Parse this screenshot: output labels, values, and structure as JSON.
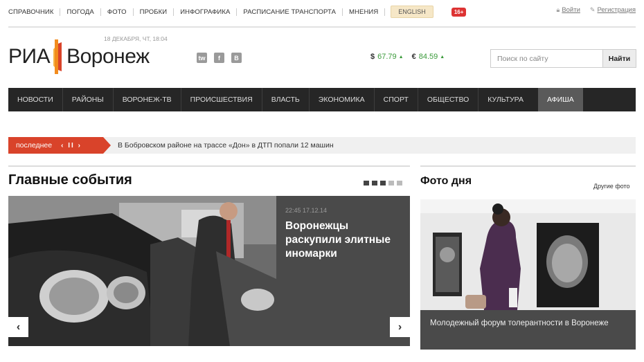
{
  "topnav": {
    "links": [
      "СПРАВОЧНИК",
      "ПОГОДА",
      "ФОТО",
      "ПРОБКИ",
      "ИНФОГРАФИКА",
      "РАСПИСАНИЕ ТРАНСПОРТА",
      "МНЕНИЯ"
    ],
    "english": "ENGLISH",
    "age_rating": "16+",
    "login": "Войти",
    "register": "Регистрация"
  },
  "header": {
    "date": "18 ДЕКАБРЯ, ЧТ, 18:04",
    "logo_left": "РИА",
    "logo_right": "Воронеж",
    "social": [
      "tw",
      "f",
      "В"
    ],
    "rates": [
      {
        "currency": "$",
        "value": "67.79"
      },
      {
        "currency": "€",
        "value": "84.59"
      }
    ],
    "search_placeholder": "Поиск по сайту",
    "search_button": "Найти"
  },
  "mainnav": {
    "items": [
      "НОВОСТИ",
      "РАЙОНЫ",
      "ВОРОНЕЖ-ТВ",
      "ПРОИСШЕСТВИЯ",
      "ВЛАСТЬ",
      "ЭКОНОМИКА",
      "СПОРТ",
      "ОБЩЕСТВО",
      "КУЛЬТУРА",
      "АФИША"
    ],
    "active": "АФИША"
  },
  "ticker": {
    "label": "последнее",
    "controls": "‹ II ›",
    "headline": "В Бобровском районе на трассе «Дон» в ДТП попали 12 машин"
  },
  "main_events": {
    "title": "Главные события",
    "slide": {
      "meta": "22:45 17.12.14",
      "headline": "Воронежцы раскупили элитные иномарки"
    },
    "prev": "‹",
    "next": "›"
  },
  "photo_of_day": {
    "title": "Фото дня",
    "more_link": "Другие фото",
    "caption": "Молодежный форум толерантности в Воронеже"
  },
  "colors": {
    "accent_red": "#d9432a",
    "nav_bg": "#262626",
    "rate_green": "#3a9a3a"
  }
}
